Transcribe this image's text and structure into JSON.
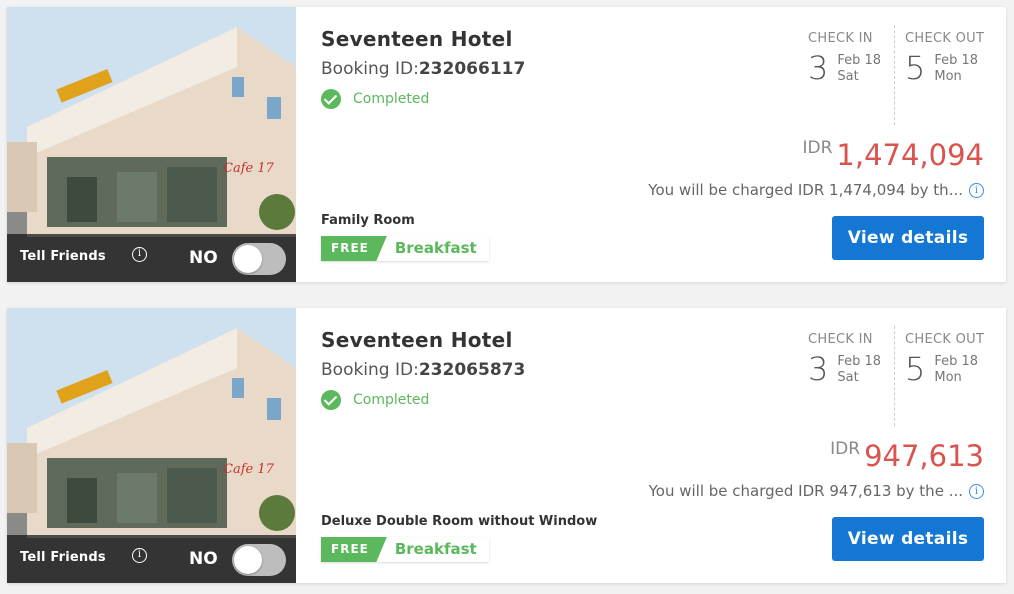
{
  "bookings": [
    {
      "hotel_name": "Seventeen Hotel",
      "booking_label": "Booking ID:",
      "booking_id": "232066117",
      "status": "Completed",
      "check_in": {
        "label": "CHECK IN",
        "day": "3",
        "month": "Feb 18",
        "weekday": "Sat"
      },
      "check_out": {
        "label": "CHECK OUT",
        "day": "5",
        "month": "Feb 18",
        "weekday": "Mon"
      },
      "currency": "IDR",
      "amount": "1,474,094",
      "charged_note": "You will be charged IDR 1,474,094 by th...",
      "room_type": "Family Room",
      "free_label": "FREE",
      "meal": "Breakfast",
      "tell_friends": "Tell Friends",
      "toggle_label": "NO",
      "view_details": "View details",
      "photo_sign": "Cafe 17"
    },
    {
      "hotel_name": "Seventeen Hotel",
      "booking_label": "Booking ID:",
      "booking_id": "232065873",
      "status": "Completed",
      "check_in": {
        "label": "CHECK IN",
        "day": "3",
        "month": "Feb 18",
        "weekday": "Sat"
      },
      "check_out": {
        "label": "CHECK OUT",
        "day": "5",
        "month": "Feb 18",
        "weekday": "Mon"
      },
      "currency": "IDR",
      "amount": "947,613",
      "charged_note": "You will be charged IDR 947,613 by the ...",
      "room_type": "Deluxe Double Room without Window",
      "free_label": "FREE",
      "meal": "Breakfast",
      "tell_friends": "Tell Friends",
      "toggle_label": "NO",
      "view_details": "View details",
      "photo_sign": "Cafe 17"
    }
  ],
  "colors": {
    "price": "#d9534f",
    "success": "#5cb85c",
    "button": "#1477d4"
  },
  "icons": {
    "status": "check-circle-icon",
    "info": "info-icon"
  }
}
